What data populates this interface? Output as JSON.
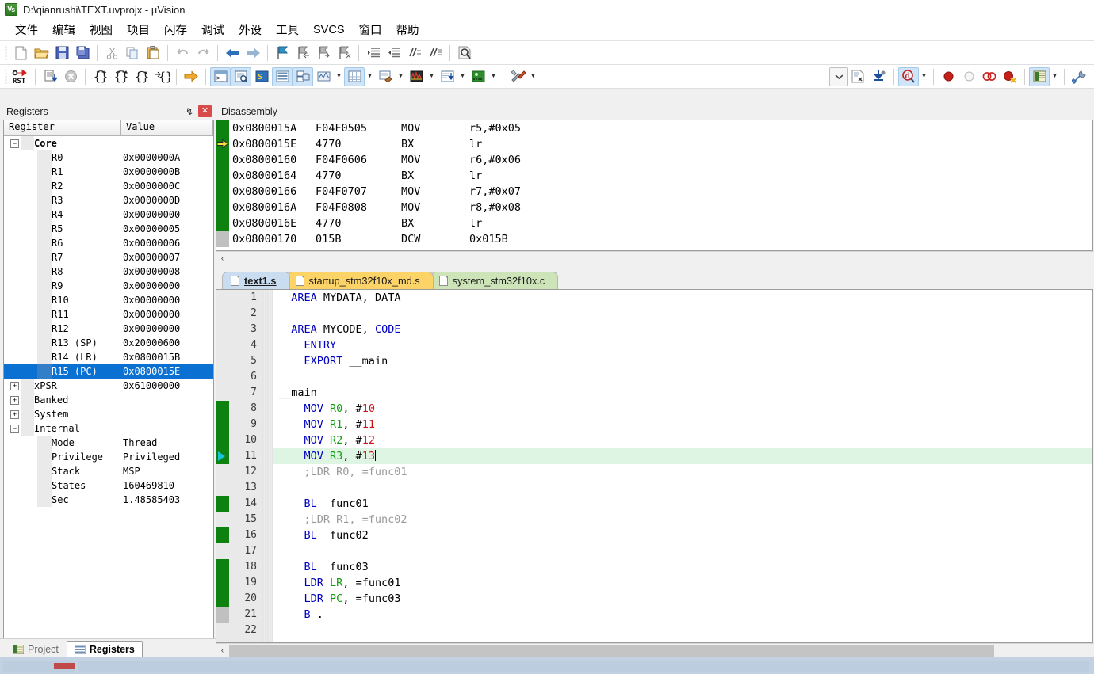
{
  "window": {
    "title": "D:\\qianrushi\\TEXT.uvprojx - µVision",
    "app_icon": "uvision-logo-icon"
  },
  "menubar": {
    "items": [
      {
        "label": "文件"
      },
      {
        "label": "编辑"
      },
      {
        "label": "视图"
      },
      {
        "label": "项目"
      },
      {
        "label": "闪存"
      },
      {
        "label": "调试"
      },
      {
        "label": "外设"
      },
      {
        "label": "工具"
      },
      {
        "label": "SVCS"
      },
      {
        "label": "窗口"
      },
      {
        "label": "帮助"
      }
    ]
  },
  "toolbar_main": {
    "icons": [
      "new-file-icon",
      "open-file-icon",
      "save-icon",
      "save-all-icon",
      "cut-icon",
      "copy-icon",
      "paste-icon",
      "undo-icon",
      "redo-icon",
      "navigate-back-icon",
      "navigate-forward-icon",
      "bookmark-toggle-icon",
      "bookmark-prev-icon",
      "bookmark-next-icon",
      "bookmark-clear-icon",
      "indent-icon",
      "outdent-icon",
      "comment-icon",
      "uncomment-icon",
      "find-in-files-icon"
    ]
  },
  "toolbar_debug": {
    "icons": [
      "reset-cpu-icon",
      "run-icon",
      "stop-icon",
      "step-into-icon",
      "step-over-icon",
      "step-out-icon",
      "run-to-cursor-icon",
      "show-next-statement-icon",
      "command-window-icon",
      "disassembly-window-icon",
      "symbols-window-icon",
      "registers-window-icon",
      "call-stack-window-icon",
      "watch-window-icon",
      "memory-window-icon",
      "serial-window-icon",
      "analysis-window-icon",
      "trace-window-icon",
      "system-viewer-icon",
      "toolbox-icon"
    ],
    "right_icons": [
      "dropdown-icon",
      "debug-settings-icon",
      "download-icon",
      "magnify-debug-icon",
      "breakpoint-insert-icon",
      "breakpoint-disable-icon",
      "breakpoint-disable-all-icon",
      "breakpoint-kill-all-icon",
      "project-window-icon",
      "configure-icon"
    ]
  },
  "registers_pane": {
    "caption": "Registers",
    "pin_glyph": "↯",
    "close_glyph": "✕",
    "columns": [
      "Register",
      "Value"
    ],
    "rows": [
      {
        "name": "Core",
        "value": "",
        "indent": 0,
        "twisty": "−",
        "bold": true,
        "selected": false
      },
      {
        "name": "R0",
        "value": "0x0000000A",
        "indent": 1,
        "selected": false
      },
      {
        "name": "R1",
        "value": "0x0000000B",
        "indent": 1,
        "selected": false
      },
      {
        "name": "R2",
        "value": "0x0000000C",
        "indent": 1,
        "selected": false
      },
      {
        "name": "R3",
        "value": "0x0000000D",
        "indent": 1,
        "selected": false
      },
      {
        "name": "R4",
        "value": "0x00000000",
        "indent": 1,
        "selected": false
      },
      {
        "name": "R5",
        "value": "0x00000005",
        "indent": 1,
        "selected": false
      },
      {
        "name": "R6",
        "value": "0x00000006",
        "indent": 1,
        "selected": false
      },
      {
        "name": "R7",
        "value": "0x00000007",
        "indent": 1,
        "selected": false
      },
      {
        "name": "R8",
        "value": "0x00000008",
        "indent": 1,
        "selected": false
      },
      {
        "name": "R9",
        "value": "0x00000000",
        "indent": 1,
        "selected": false
      },
      {
        "name": "R10",
        "value": "0x00000000",
        "indent": 1,
        "selected": false
      },
      {
        "name": "R11",
        "value": "0x00000000",
        "indent": 1,
        "selected": false
      },
      {
        "name": "R12",
        "value": "0x00000000",
        "indent": 1,
        "selected": false
      },
      {
        "name": "R13 (SP)",
        "value": "0x20000600",
        "indent": 1,
        "selected": false
      },
      {
        "name": "R14 (LR)",
        "value": "0x0800015B",
        "indent": 1,
        "selected": false
      },
      {
        "name": "R15 (PC)",
        "value": "0x0800015E",
        "indent": 1,
        "selected": true
      },
      {
        "name": "xPSR",
        "value": "0x61000000",
        "indent": 0,
        "twisty": "+",
        "selected": false
      },
      {
        "name": "Banked",
        "value": "",
        "indent": 0,
        "twisty": "+",
        "selected": false
      },
      {
        "name": "System",
        "value": "",
        "indent": 0,
        "twisty": "+",
        "selected": false
      },
      {
        "name": "Internal",
        "value": "",
        "indent": 0,
        "twisty": "−",
        "selected": false
      },
      {
        "name": "Mode",
        "value": "Thread",
        "indent": 1,
        "selected": false
      },
      {
        "name": "Privilege",
        "value": "Privileged",
        "indent": 1,
        "selected": false
      },
      {
        "name": "Stack",
        "value": "MSP",
        "indent": 1,
        "selected": false
      },
      {
        "name": "States",
        "value": "160469810",
        "indent": 1,
        "selected": false
      },
      {
        "name": "Sec",
        "value": "1.48585403",
        "indent": 1,
        "selected": false
      }
    ],
    "bottom_tabs": [
      {
        "label": "Project",
        "icon": "project-icon",
        "active": false
      },
      {
        "label": "Registers",
        "icon": "registers-icon",
        "active": true
      }
    ]
  },
  "disassembly": {
    "caption": "Disassembly",
    "scroll_left_glyph": "‹",
    "rows": [
      {
        "address": "0x0800015A",
        "opcode": "F04F0505",
        "mnemonic": "MOV",
        "operands": "r5,#0x05",
        "gutter": "green",
        "pc": false
      },
      {
        "address": "0x0800015E",
        "opcode": "4770",
        "mnemonic": "BX",
        "operands": "lr",
        "gutter": "green",
        "pc": true
      },
      {
        "address": "0x08000160",
        "opcode": "F04F0606",
        "mnemonic": "MOV",
        "operands": "r6,#0x06",
        "gutter": "green",
        "pc": false
      },
      {
        "address": "0x08000164",
        "opcode": "4770",
        "mnemonic": "BX",
        "operands": "lr",
        "gutter": "green",
        "pc": false
      },
      {
        "address": "0x08000166",
        "opcode": "F04F0707",
        "mnemonic": "MOV",
        "operands": "r7,#0x07",
        "gutter": "green",
        "pc": false
      },
      {
        "address": "0x0800016A",
        "opcode": "F04F0808",
        "mnemonic": "MOV",
        "operands": "r8,#0x08",
        "gutter": "green",
        "pc": false
      },
      {
        "address": "0x0800016E",
        "opcode": "4770",
        "mnemonic": "BX",
        "operands": "lr",
        "gutter": "green",
        "pc": false
      },
      {
        "address": "0x08000170",
        "opcode": "015B",
        "mnemonic": "DCW",
        "operands": "0x015B",
        "gutter": "grey",
        "pc": false
      }
    ]
  },
  "editor": {
    "tabs": [
      {
        "label": "text1.s",
        "color": "blue",
        "active": true
      },
      {
        "label": "startup_stm32f10x_md.s",
        "color": "orange",
        "active": false
      },
      {
        "label": "system_stm32f10x.c",
        "color": "green",
        "active": false
      }
    ],
    "scroll_left_glyph": "‹",
    "lines": [
      {
        "n": "1",
        "gutter": "empty",
        "highlight": false,
        "current": false,
        "tokens": [
          {
            "t": "  ",
            "c": ""
          },
          {
            "t": "AREA",
            "c": "kw"
          },
          {
            "t": " MYDATA, ",
            "c": ""
          },
          {
            "t": "DATA",
            "c": ""
          }
        ]
      },
      {
        "n": "2",
        "gutter": "empty",
        "highlight": false,
        "current": false,
        "tokens": []
      },
      {
        "n": "3",
        "gutter": "empty",
        "highlight": false,
        "current": false,
        "tokens": [
          {
            "t": "  ",
            "c": ""
          },
          {
            "t": "AREA",
            "c": "kw"
          },
          {
            "t": " MYCODE, ",
            "c": ""
          },
          {
            "t": "CODE",
            "c": "kw"
          }
        ]
      },
      {
        "n": "4",
        "gutter": "empty",
        "highlight": false,
        "current": false,
        "tokens": [
          {
            "t": "    ",
            "c": ""
          },
          {
            "t": "ENTRY",
            "c": "kw"
          }
        ]
      },
      {
        "n": "5",
        "gutter": "empty",
        "highlight": false,
        "current": false,
        "tokens": [
          {
            "t": "    ",
            "c": ""
          },
          {
            "t": "EXPORT",
            "c": "kw"
          },
          {
            "t": " __main",
            "c": ""
          }
        ]
      },
      {
        "n": "6",
        "gutter": "empty",
        "highlight": false,
        "current": false,
        "tokens": []
      },
      {
        "n": "7",
        "gutter": "empty",
        "highlight": false,
        "current": false,
        "tokens": [
          {
            "t": "__main",
            "c": ""
          }
        ]
      },
      {
        "n": "8",
        "gutter": "green",
        "highlight": false,
        "current": false,
        "tokens": [
          {
            "t": "    ",
            "c": ""
          },
          {
            "t": "MOV",
            "c": "kw"
          },
          {
            "t": " ",
            "c": ""
          },
          {
            "t": "R0",
            "c": "reg"
          },
          {
            "t": ", #",
            "c": ""
          },
          {
            "t": "10",
            "c": "num"
          }
        ]
      },
      {
        "n": "9",
        "gutter": "green",
        "highlight": false,
        "current": false,
        "tokens": [
          {
            "t": "    ",
            "c": ""
          },
          {
            "t": "MOV",
            "c": "kw"
          },
          {
            "t": " ",
            "c": ""
          },
          {
            "t": "R1",
            "c": "reg"
          },
          {
            "t": ", #",
            "c": ""
          },
          {
            "t": "11",
            "c": "num"
          }
        ]
      },
      {
        "n": "10",
        "gutter": "green",
        "highlight": false,
        "current": false,
        "tokens": [
          {
            "t": "    ",
            "c": ""
          },
          {
            "t": "MOV",
            "c": "kw"
          },
          {
            "t": " ",
            "c": ""
          },
          {
            "t": "R2",
            "c": "reg"
          },
          {
            "t": ", #",
            "c": ""
          },
          {
            "t": "12",
            "c": "num"
          }
        ]
      },
      {
        "n": "11",
        "gutter": "green",
        "highlight": true,
        "current": true,
        "tokens": [
          {
            "t": "    ",
            "c": ""
          },
          {
            "t": "MOV",
            "c": "kw"
          },
          {
            "t": " ",
            "c": ""
          },
          {
            "t": "R3",
            "c": "reg"
          },
          {
            "t": ", #",
            "c": ""
          },
          {
            "t": "13",
            "c": "num"
          }
        ]
      },
      {
        "n": "12",
        "gutter": "empty",
        "highlight": false,
        "current": false,
        "tokens": [
          {
            "t": "    ;LDR R0, =func01",
            "c": "cmt"
          }
        ]
      },
      {
        "n": "13",
        "gutter": "empty",
        "highlight": false,
        "current": false,
        "tokens": []
      },
      {
        "n": "14",
        "gutter": "green",
        "highlight": false,
        "current": false,
        "tokens": [
          {
            "t": "    ",
            "c": ""
          },
          {
            "t": "BL",
            "c": "kw"
          },
          {
            "t": "  func01",
            "c": ""
          }
        ]
      },
      {
        "n": "15",
        "gutter": "empty",
        "highlight": false,
        "current": false,
        "tokens": [
          {
            "t": "    ;LDR R1, =func02",
            "c": "cmt"
          }
        ]
      },
      {
        "n": "16",
        "gutter": "green",
        "highlight": false,
        "current": false,
        "tokens": [
          {
            "t": "    ",
            "c": ""
          },
          {
            "t": "BL",
            "c": "kw"
          },
          {
            "t": "  func02",
            "c": ""
          }
        ]
      },
      {
        "n": "17",
        "gutter": "empty",
        "highlight": false,
        "current": false,
        "tokens": []
      },
      {
        "n": "18",
        "gutter": "green",
        "highlight": false,
        "current": false,
        "tokens": [
          {
            "t": "    ",
            "c": ""
          },
          {
            "t": "BL",
            "c": "kw"
          },
          {
            "t": "  func03",
            "c": ""
          }
        ]
      },
      {
        "n": "19",
        "gutter": "green",
        "highlight": false,
        "current": false,
        "tokens": [
          {
            "t": "    ",
            "c": ""
          },
          {
            "t": "LDR",
            "c": "kw"
          },
          {
            "t": " ",
            "c": ""
          },
          {
            "t": "LR",
            "c": "reg"
          },
          {
            "t": ", =func01",
            "c": ""
          }
        ]
      },
      {
        "n": "20",
        "gutter": "green",
        "highlight": false,
        "current": false,
        "tokens": [
          {
            "t": "    ",
            "c": ""
          },
          {
            "t": "LDR",
            "c": "kw"
          },
          {
            "t": " ",
            "c": ""
          },
          {
            "t": "PC",
            "c": "reg"
          },
          {
            "t": ", =func03",
            "c": ""
          }
        ]
      },
      {
        "n": "21",
        "gutter": "grey",
        "highlight": false,
        "current": false,
        "tokens": [
          {
            "t": "    ",
            "c": ""
          },
          {
            "t": "B",
            "c": "kw"
          },
          {
            "t": " .",
            "c": ""
          }
        ]
      },
      {
        "n": "22",
        "gutter": "empty",
        "highlight": false,
        "current": false,
        "tokens": []
      }
    ]
  },
  "statusbar": {
    "left_text": "",
    "right_text": ""
  }
}
